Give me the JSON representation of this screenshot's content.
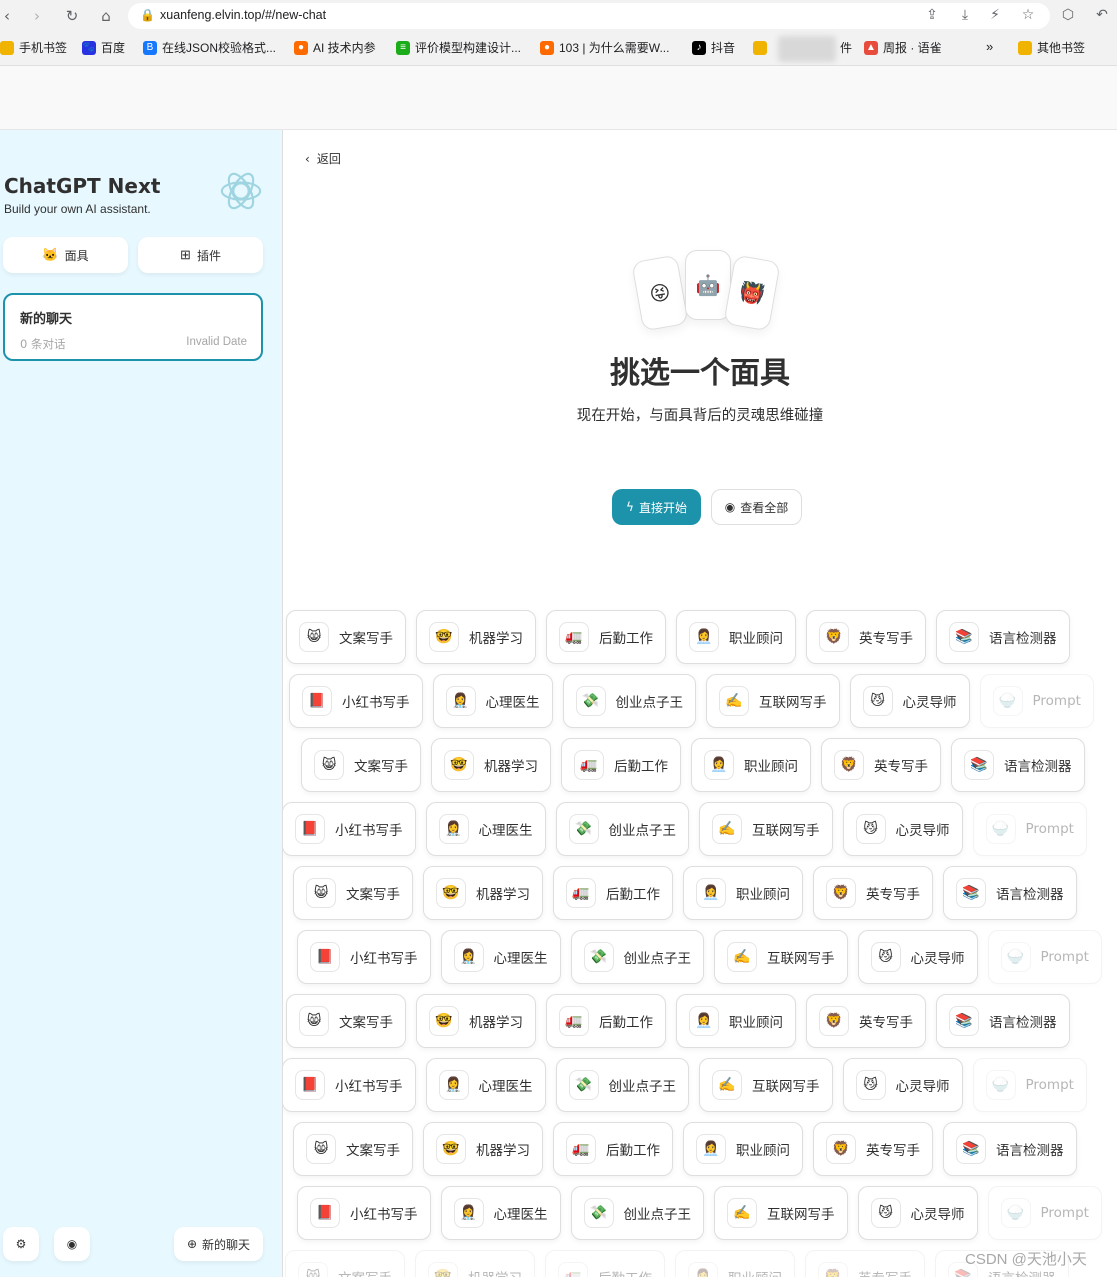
{
  "browser": {
    "url": "xuanfeng.elvin.top/#/new-chat",
    "bookmarks": [
      {
        "label": "手机书签",
        "icon": "folder-icon",
        "color": "#f0b400"
      },
      {
        "label": "百度",
        "icon": "baidu-icon",
        "color": "#2932e1"
      },
      {
        "label": "在线JSON校验格式...",
        "icon": "json-icon",
        "color": "#1677ff"
      },
      {
        "label": "AI 技术内参",
        "icon": "ai-icon",
        "color": "#ff6a00"
      },
      {
        "label": "评价模型构建设计...",
        "icon": "doc-icon",
        "color": "#1aad19"
      },
      {
        "label": "103 | 为什么需要W...",
        "icon": "ai-icon",
        "color": "#ff6a00"
      },
      {
        "label": "抖音",
        "icon": "douyin-icon",
        "color": "#000000"
      },
      {
        "label": "件",
        "icon": "folder-icon",
        "color": "#f0b400"
      },
      {
        "label": "周报 · 语雀",
        "icon": "yuque-icon",
        "color": "#e84c3d"
      },
      {
        "label": "其他书签",
        "icon": "folder-icon",
        "color": "#f0b400"
      }
    ]
  },
  "sidebar": {
    "title": "ChatGPT Next",
    "subtitle": "Build your own AI assistant.",
    "mask_button": "面具",
    "plugin_button": "插件",
    "chat": {
      "title": "新的聊天",
      "count": "0 条对话",
      "date": "Invalid Date"
    },
    "new_chat_button": "新的聊天"
  },
  "main": {
    "back": "返回",
    "title": "挑选一个面具",
    "subtitle": "现在开始，与面具背后的灵魂思维碰撞",
    "start_button": "直接开始",
    "view_all_button": "查看全部",
    "card_emojis": [
      "😝",
      "🤖",
      "👹"
    ]
  },
  "masks": {
    "row_a": [
      {
        "emoji": "😸",
        "name": "文案写手"
      },
      {
        "emoji": "🤓",
        "name": "机器学习"
      },
      {
        "emoji": "🚛",
        "name": "后勤工作"
      },
      {
        "emoji": "👩‍💼",
        "name": "职业顾问"
      },
      {
        "emoji": "🦁",
        "name": "英专写手"
      },
      {
        "emoji": "📚",
        "name": "语言检测器"
      }
    ],
    "row_b": [
      {
        "emoji": "📕",
        "name": "小红书写手"
      },
      {
        "emoji": "👩‍⚕️",
        "name": "心理医生"
      },
      {
        "emoji": "💸",
        "name": "创业点子王"
      },
      {
        "emoji": "✍️",
        "name": "互联网写手"
      },
      {
        "emoji": "😼",
        "name": "心灵导师"
      },
      {
        "emoji": "🍚",
        "name": "Prompt"
      }
    ]
  },
  "watermark": "CSDN @天池小天"
}
